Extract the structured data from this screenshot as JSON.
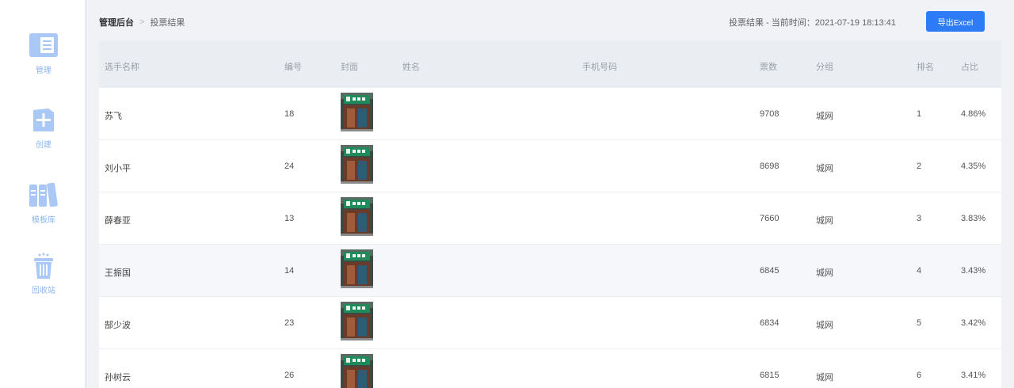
{
  "sidebar": {
    "items": [
      {
        "label": "管理",
        "icon": "document-icon"
      },
      {
        "label": "创建",
        "icon": "plus-icon"
      },
      {
        "label": "模板库",
        "icon": "books-icon"
      },
      {
        "label": "回收站",
        "icon": "trash-icon"
      }
    ]
  },
  "header": {
    "breadcrumb_root": "管理后台",
    "breadcrumb_sep": ">",
    "breadcrumb_current": "投票结果",
    "status": "投票结果 - 当前时间：2021-07-19 18:13:41",
    "export_label": "导出Excel"
  },
  "table": {
    "columns": [
      "选手名称",
      "编号",
      "封面",
      "姓名",
      "手机号码",
      "票数",
      "分组",
      "排名",
      "占比"
    ],
    "rows": [
      {
        "name": "苏飞",
        "num": "18",
        "realname": "",
        "phone": "",
        "votes": "9708",
        "group": "城网",
        "rank": "1",
        "ratio": "4.86%"
      },
      {
        "name": "刘小平",
        "num": "24",
        "realname": "",
        "phone": "",
        "votes": "8698",
        "group": "城网",
        "rank": "2",
        "ratio": "4.35%"
      },
      {
        "name": "薛春亚",
        "num": "13",
        "realname": "",
        "phone": "",
        "votes": "7660",
        "group": "城网",
        "rank": "3",
        "ratio": "3.83%"
      },
      {
        "name": "王振国",
        "num": "14",
        "realname": "",
        "phone": "",
        "votes": "6845",
        "group": "城网",
        "rank": "4",
        "ratio": "3.43%"
      },
      {
        "name": "郜少波",
        "num": "23",
        "realname": "",
        "phone": "",
        "votes": "6834",
        "group": "城网",
        "rank": "5",
        "ratio": "3.42%"
      },
      {
        "name": "孙树云",
        "num": "26",
        "realname": "",
        "phone": "",
        "votes": "6815",
        "group": "城网",
        "rank": "6",
        "ratio": "3.41%"
      }
    ]
  },
  "colors": {
    "accent": "#2d7cf6",
    "sidebar_icon": "#8eb4ee",
    "header_bg": "#eaedf2",
    "page_bg": "#f0f2f5"
  }
}
